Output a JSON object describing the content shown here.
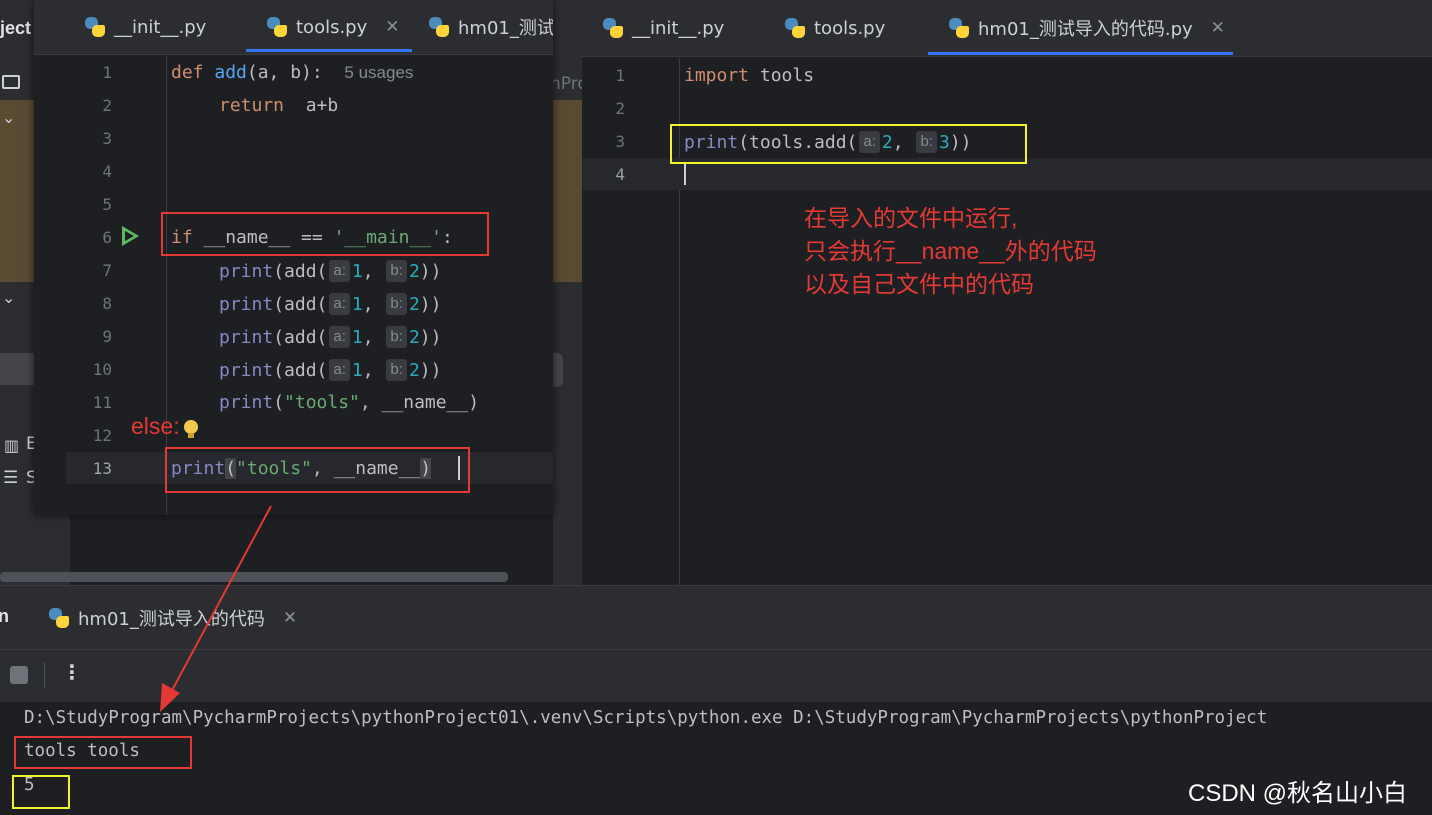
{
  "left_sidebar": {
    "project_label": "ject",
    "tree_label_fragment": "nPro",
    "item_fragments": [
      "E",
      "S"
    ]
  },
  "left_editor": {
    "tabs": [
      {
        "label": "__init__.py",
        "active": false
      },
      {
        "label": "tools.py",
        "active": true,
        "close": "✕"
      },
      {
        "label": "hm01_测试",
        "active": false
      }
    ],
    "bg_fragment": "nPro",
    "lines": [
      "1",
      "2",
      "3",
      "4",
      "5",
      "6",
      "7",
      "8",
      "9",
      "10",
      "11",
      "12",
      "13"
    ],
    "code": {
      "l1_def": "def",
      "l1_name": "add",
      "l1_params": "(a, b):",
      "l1_usages": "5 usages",
      "l2_return": "return",
      "l2_expr": "a+b",
      "l6_if": "if",
      "l6_mid": " __name__ == ",
      "l6_str": "'__main__'",
      "l6_end": ":",
      "print_kw": "print",
      "add_call": "(add(",
      "hint_a": "a:",
      "hint_b": "b:",
      "val_1": "1",
      "val_2": "2",
      "comma": ", ",
      "close_call": "))",
      "l11_open": "(",
      "l11_str": "\"tools\"",
      "l11_rest": ", __name__)",
      "l13_print": "print",
      "l13_open": "(",
      "l13_str": "\"tools\"",
      "l13_rest": ", __name__",
      "l13_close": ")"
    }
  },
  "right_editor": {
    "tabs": [
      {
        "label": "__init__.py",
        "active": false
      },
      {
        "label": "tools.py",
        "active": false
      },
      {
        "label": "hm01_测试导入的代码.py",
        "active": true,
        "close": "✕"
      }
    ],
    "lines": [
      "1",
      "2",
      "3",
      "4"
    ],
    "code": {
      "l1_import": "import",
      "l1_mod": " tools",
      "l3_print": "print",
      "l3_call": "(tools.add(",
      "hint_a": "a:",
      "val_a": "2",
      "comma": ", ",
      "hint_b": "b:",
      "val_b": "3",
      "close": "))"
    }
  },
  "annotations": {
    "right_note": "在导入的文件中运行,\n只会执行__name__外的代码\n以及自己文件中的代码",
    "else_label": "else:"
  },
  "run_panel": {
    "panel_label": "n",
    "tab_label": "hm01_测试导入的代码",
    "tab_close": "✕",
    "toolbar": {
      "stop_icon": "stop-icon",
      "more": "⋮"
    },
    "output": [
      "D:\\StudyProgram\\PycharmProjects\\pythonProject01\\.venv\\Scripts\\python.exe D:\\StudyProgram\\PycharmProjects\\pythonProject",
      "tools tools",
      "5"
    ]
  },
  "watermark": "CSDN @秋名山小白",
  "colors": {
    "accent": "#3574f0",
    "annotation_red": "#e53935",
    "annotation_yellow": "#f2f22d"
  }
}
